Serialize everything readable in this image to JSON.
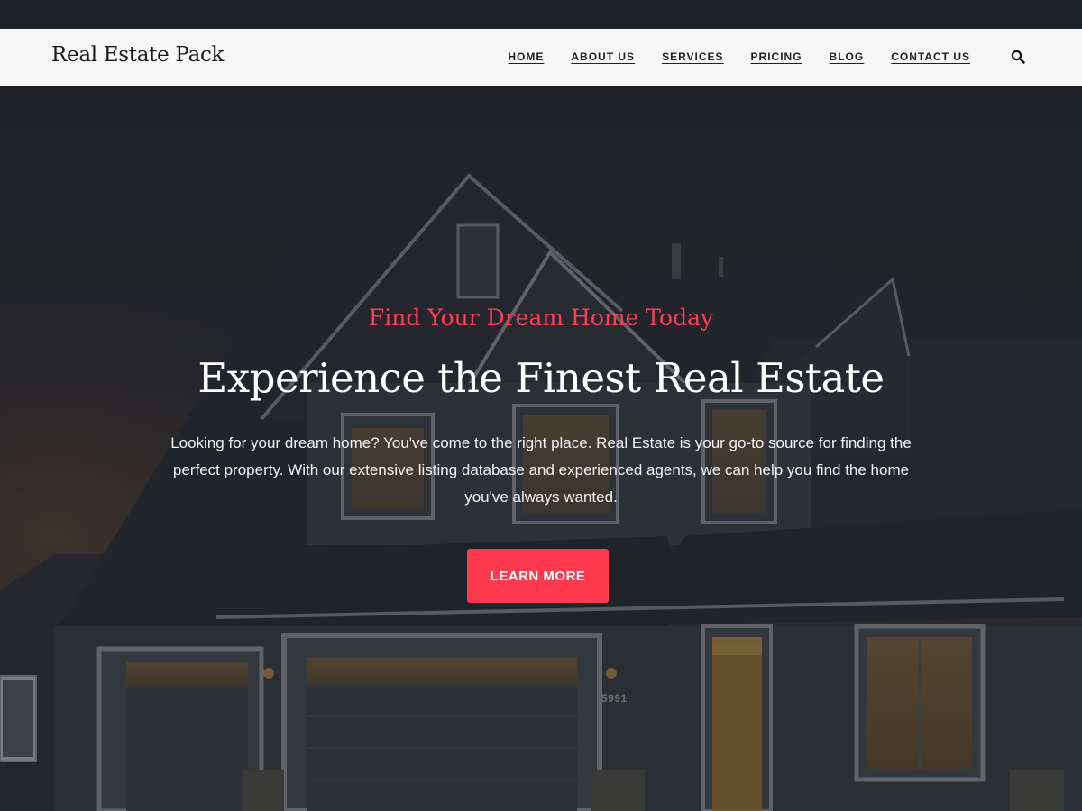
{
  "site": {
    "brand": "Real Estate Pack"
  },
  "nav": {
    "items": [
      {
        "label": "HOME"
      },
      {
        "label": "ABOUT US"
      },
      {
        "label": "SERVICES"
      },
      {
        "label": "PRICING"
      },
      {
        "label": "BLOG"
      },
      {
        "label": "CONTACT US"
      }
    ],
    "search_icon": "search-icon"
  },
  "hero": {
    "eyebrow": "Find Your Dream Home Today",
    "headline": "Experience the Finest Real Estate",
    "description": "Looking for your dream home? You've come to the right place. Real Estate is your go-to source for finding the perfect property. With our extensive listing database and experienced agents, we can help you find the home you've always wanted.",
    "cta_label": "LEARN MORE",
    "house_number": "5991"
  },
  "colors": {
    "accent": "#ff3a4e",
    "eyebrow": "#ff3d55",
    "topbar": "#1c2226",
    "navbar": "#f7f7f7"
  }
}
